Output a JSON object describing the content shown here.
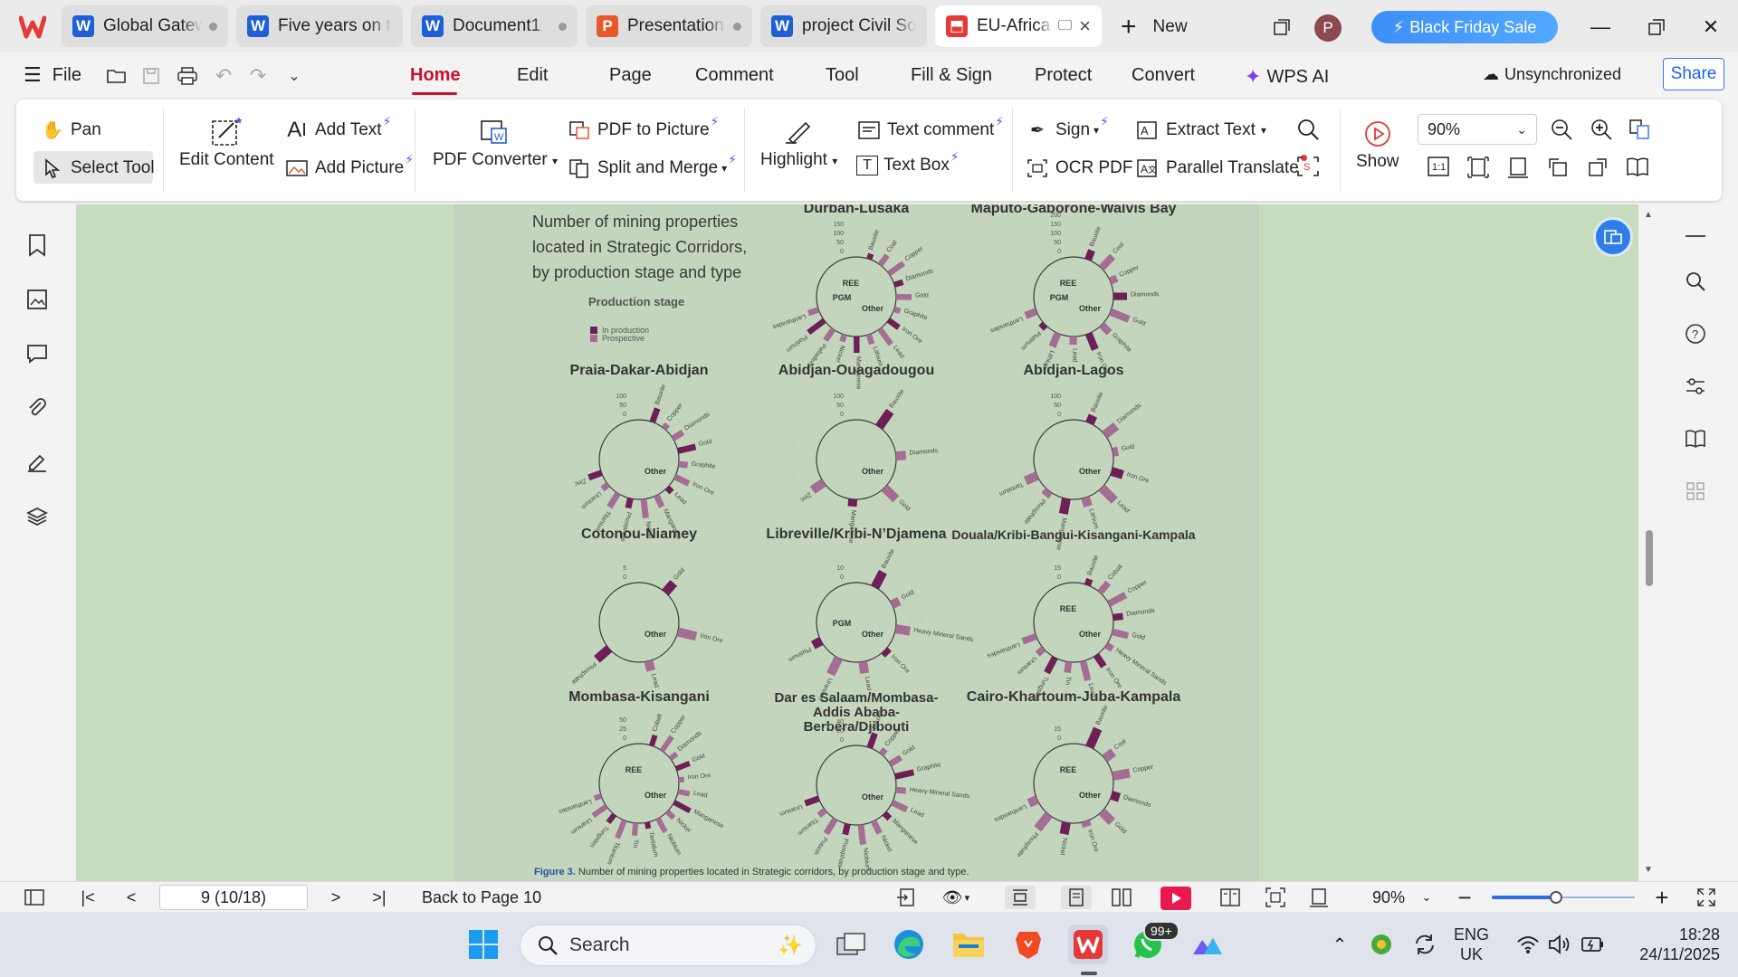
{
  "tabs": [
    {
      "label": "Global Gateway",
      "type": "w",
      "state": "dot"
    },
    {
      "label": "Five years on this",
      "type": "w",
      "state": "none"
    },
    {
      "label": "Document1",
      "type": "w",
      "state": "dot"
    },
    {
      "label": "Presentation",
      "type": "p",
      "state": "dot"
    },
    {
      "label": "project Civil Society",
      "type": "w",
      "state": "none"
    },
    {
      "label": "EU-Africa",
      "type": "pdf",
      "state": "close"
    }
  ],
  "tabbar": {
    "new_label": "New",
    "profile_initial": "P",
    "promo_label": "Black Friday Sale"
  },
  "menubar": {
    "file_label": "File",
    "tabs": [
      "Home",
      "Edit",
      "Page",
      "Comment",
      "Tool",
      "Fill & Sign",
      "Protect",
      "Convert"
    ],
    "wps_ai_label": "WPS AI",
    "sync_label": "Unsynchronized",
    "share_label": "Share"
  },
  "ribbon": {
    "pan": "Pan",
    "select_tool": "Select Tool",
    "edit_content": "Edit Content",
    "add_text": "Add Text",
    "add_picture": "Add Picture",
    "pdf_converter": "PDF Converter",
    "pdf_to_picture": "PDF to Picture",
    "split_merge": "Split and Merge",
    "highlight": "Highlight",
    "text_comment": "Text comment",
    "text_box": "Text Box",
    "sign": "Sign",
    "ocr_pdf": "OCR PDF",
    "extract_text": "Extract Text",
    "parallel_translate": "Parallel Translate",
    "show": "Show",
    "zoom": "90%"
  },
  "document": {
    "intro": "Number of mining properties located in Strategic Corridors, by production stage and type",
    "legend_title": "Production stage",
    "legend_items": [
      {
        "label": "In production",
        "color": "#6d1f56"
      },
      {
        "label": "Prospective",
        "color": "#a46e92"
      }
    ],
    "corridors": [
      {
        "title": "Durban-Lusaka",
        "center_labels": [
          "REE",
          "PGM",
          "Other"
        ],
        "ticks": [
          "150",
          "100",
          "50",
          "0"
        ],
        "minerals": [
          "Bauxite",
          "Coal",
          "Copper",
          "Diamonds",
          "Gold",
          "Graphite",
          "Iron Ore",
          "Lead",
          "Lithium",
          "Manganese",
          "Nickel",
          "Palladium",
          "Platinum",
          "Lanthanides"
        ]
      },
      {
        "title": "Maputo-Gaborone-Walvis Bay",
        "center_labels": [
          "REE",
          "PGM",
          "Other"
        ],
        "ticks": [
          "200",
          "150",
          "100",
          "50",
          "0"
        ],
        "minerals": [
          "Bauxite",
          "Coal",
          "Copper",
          "Diamonds",
          "Gold",
          "Graphite",
          "Iron Ore",
          "Lead",
          "Lithium",
          "Platinum",
          "Lanthanides"
        ]
      },
      {
        "title": "Praia-Dakar-Abidjan",
        "center_labels": [
          "Other"
        ],
        "ticks": [
          "100",
          "50",
          "0"
        ],
        "minerals": [
          "Bauxite",
          "Copper",
          "Diamonds",
          "Gold",
          "Graphite",
          "Iron Ore",
          "Lead",
          "Manganese",
          "Nickel",
          "Phosphate",
          "Titanium",
          "Uranium",
          "Zinc"
        ]
      },
      {
        "title": "Abidjan-Ouagadougou",
        "center_labels": [
          "Other"
        ],
        "ticks": [
          "100",
          "50",
          "0"
        ],
        "minerals": [
          "Bauxite",
          "Diamonds",
          "Gold",
          "Manganese",
          "Zinc"
        ]
      },
      {
        "title": "Abidjan-Lagos",
        "center_labels": [
          "Other"
        ],
        "ticks": [
          "100",
          "50",
          "0"
        ],
        "minerals": [
          "Bauxite",
          "Diamonds",
          "Gold",
          "Iron Ore",
          "Lead",
          "Lithium",
          "Manganese",
          "Phosphate",
          "Tantalum"
        ]
      },
      {
        "title": "Cotonou-Niamey",
        "center_labels": [
          "Other"
        ],
        "ticks": [
          "5",
          "0"
        ],
        "minerals": [
          "Gold",
          "Iron Ore",
          "Lead",
          "Phosphate"
        ]
      },
      {
        "title": "Libreville/Kribi-N’Djamena",
        "center_labels": [
          "PGM",
          "Other"
        ],
        "ticks": [
          "10",
          "0"
        ],
        "minerals": [
          "Bauxite",
          "Gold",
          "Heavy Mineral Sands",
          "Iron Ore",
          "Lead",
          "Uranium",
          "Platinum"
        ]
      },
      {
        "title": "Douala/Kribi-Bangui-Kisangani-Kampala",
        "center_labels": [
          "REE",
          "Other"
        ],
        "ticks": [
          "15",
          "0"
        ],
        "minerals": [
          "Bauxite",
          "Cobalt",
          "Copper",
          "Diamonds",
          "Gold",
          "Heavy Mineral Sands",
          "Iron Ore",
          "Lead",
          "Tin",
          "Tungsten",
          "Uranium",
          "Lanthanides"
        ]
      },
      {
        "title": "Mombasa-Kisangani",
        "center_labels": [
          "REE",
          "Other"
        ],
        "ticks": [
          "50",
          "25",
          "0"
        ],
        "minerals": [
          "Cobalt",
          "Copper",
          "Diamonds",
          "Gold",
          "Iron Ore",
          "Lead",
          "Manganese",
          "Nickel",
          "Niobium",
          "Tantalum",
          "Tin",
          "Titanium",
          "Tungsten",
          "Uranium",
          "Lanthanides"
        ]
      },
      {
        "title": "Dar es Salaam/Mombasa-Addis Ababa-Berbera/Djibouti",
        "center_labels": [
          "Other"
        ],
        "ticks": [
          "40",
          "20",
          "0"
        ],
        "minerals": [
          "Bauxite",
          "Copper",
          "Gold",
          "Graphite",
          "Heavy Mineral Sands",
          "Lead",
          "Manganese",
          "Nickel",
          "Niobium",
          "Phosphate",
          "Potash",
          "Titanium",
          "Uranium"
        ]
      },
      {
        "title": "Cairo-Khartoum-Juba-Kampala",
        "center_labels": [
          "REE",
          "Other"
        ],
        "ticks": [
          "15",
          "0"
        ],
        "minerals": [
          "Bauxite",
          "Coal",
          "Copper",
          "Diamonds",
          "Gold",
          "Iron Ore",
          "Nickel",
          "Phosphate",
          "Lanthanides"
        ]
      }
    ],
    "caption_label": "Figure 3.",
    "caption_text": "Number of mining properties located in Strategic corridors, by production stage and type."
  },
  "statusbar": {
    "page_value": "9 (10/18)",
    "back_label": "Back to Page 10",
    "zoom": "90%"
  },
  "taskbar": {
    "search_label": "Search",
    "badge": "99+",
    "lang": "ENG",
    "region": "UK",
    "time": "18:28",
    "date": "24/11/2025"
  },
  "colors": {
    "accent_red": "#c8102e",
    "in_production": "#6d1f56",
    "prospective": "#a46e92",
    "doc_bg": "#c3d6bd"
  }
}
